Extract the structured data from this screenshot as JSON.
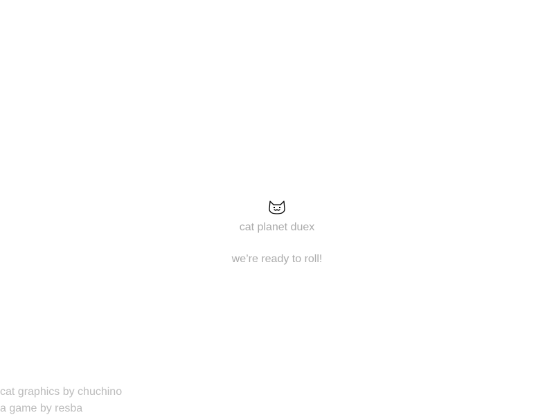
{
  "game": {
    "title": "cat planet duex",
    "status": "we’re ready to roll!",
    "logo_icon": "cat-face-icon"
  },
  "credits": {
    "graphics": "cat graphics by chuchino",
    "author": "a game by resba"
  },
  "colors": {
    "background": "#ffffff",
    "text": "#aaaaaa",
    "credits_text": "#bbbbbb",
    "icon_stroke": "#000000"
  }
}
